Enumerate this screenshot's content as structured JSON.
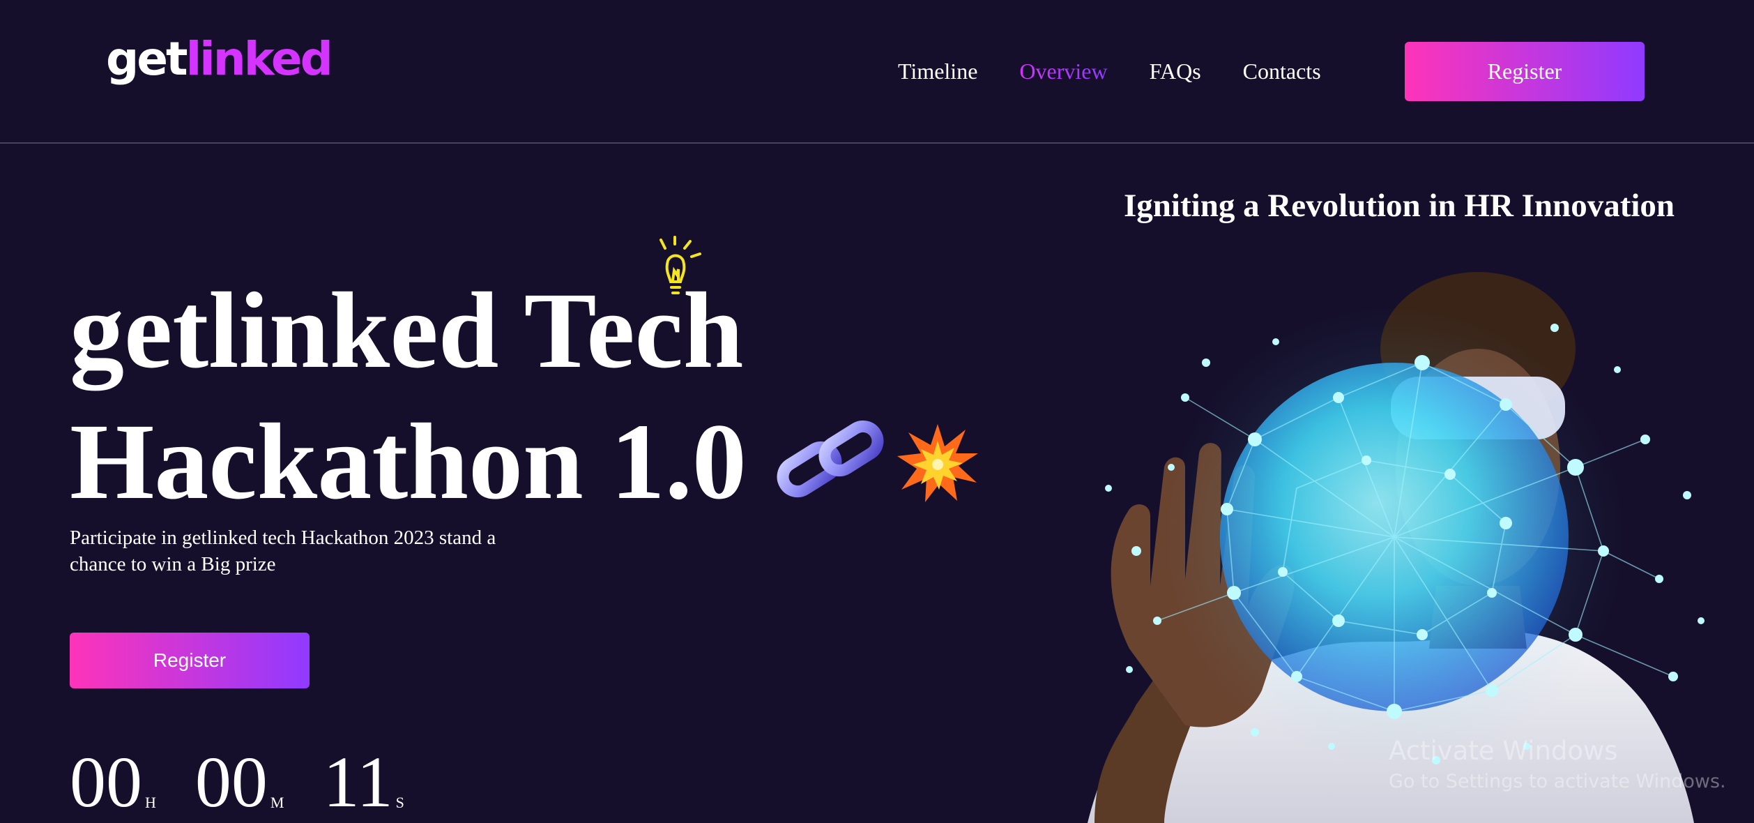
{
  "header": {
    "logo": {
      "part1": "get",
      "part2": "linked"
    },
    "nav": [
      {
        "label": "Timeline",
        "active": false
      },
      {
        "label": "Overview",
        "active": true
      },
      {
        "label": "FAQs",
        "active": false
      },
      {
        "label": "Contacts",
        "active": false
      }
    ],
    "register_label": "Register"
  },
  "hero": {
    "tagline": "Igniting a Revolution in HR Innovation",
    "title_line1": "getlinked Tech",
    "title_line2": "Hackathon 1.0",
    "description": "Participate in getlinked tech Hackathon 2023 stand a chance to win a Big prize",
    "register_label": "Register",
    "icons": [
      "lightbulb-icon",
      "chain-link-icon",
      "explosion-icon"
    ]
  },
  "countdown": {
    "hours": "00",
    "hours_unit": "H",
    "minutes": "00",
    "minutes_unit": "M",
    "seconds": "11",
    "seconds_unit": "S"
  },
  "watermark": {
    "title": "Activate Windows",
    "subtitle": "Go to Settings to activate Windows."
  },
  "colors": {
    "background": "#150f2b",
    "accent_pink": "#fe34b9",
    "accent_purple": "#903aff",
    "logo_accent": "#d434fe"
  }
}
